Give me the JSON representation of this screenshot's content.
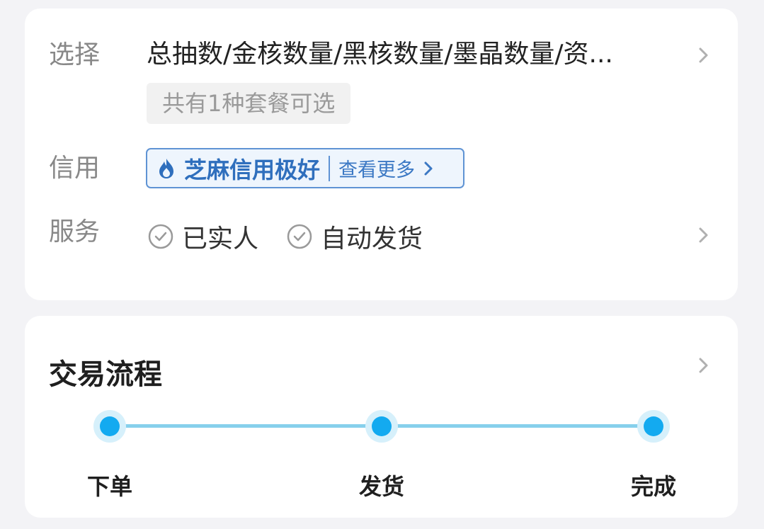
{
  "info": {
    "select": {
      "label": "选择",
      "value": "总抽数/金核数量/黑核数量/墨晶数量/资...",
      "combo_note": "共有1种套餐可选"
    },
    "credit": {
      "label": "信用",
      "badge_text": "芝麻信用极好",
      "more_text": "查看更多"
    },
    "service": {
      "label": "服务",
      "items": [
        "已实人",
        "自动发货"
      ]
    }
  },
  "flow": {
    "title": "交易流程",
    "steps": [
      "下单",
      "发货",
      "完成"
    ]
  },
  "colors": {
    "accent": "#13aaf0",
    "credit_blue": "#2f6fbd"
  },
  "icons": [
    "chevron-right-icon",
    "flame-icon",
    "check-circle-icon"
  ]
}
